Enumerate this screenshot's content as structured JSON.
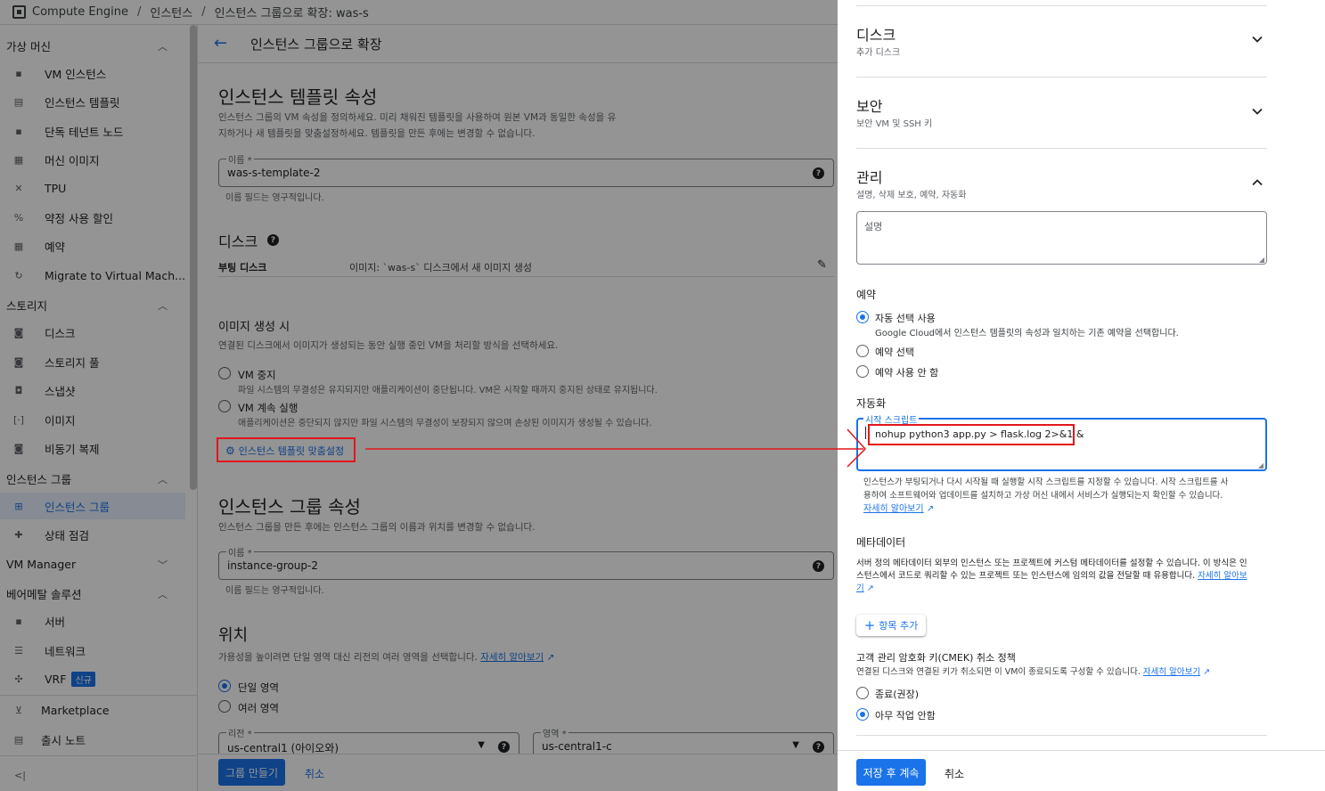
{
  "breadcrumb": {
    "product": "Compute Engine",
    "section": "인스턴스",
    "current": "인스턴스 그룹으로 확장: was-s"
  },
  "sidebar": {
    "sections": [
      {
        "label": "가상 머신"
      },
      {
        "label": "스토리지"
      },
      {
        "label": "인스턴스 그룹"
      },
      {
        "label": "VM Manager"
      },
      {
        "label": "베어메탈 솔루션"
      }
    ],
    "items": [
      {
        "label": "VM 인스턴스"
      },
      {
        "label": "인스턴스 템플릿"
      },
      {
        "label": "단독 테넌트 노드"
      },
      {
        "label": "머신 이미지"
      },
      {
        "label": "TPU"
      },
      {
        "label": "약정 사용 할인"
      },
      {
        "label": "예약"
      },
      {
        "label": "Migrate to Virtual Mach..."
      },
      {
        "label": "디스크"
      },
      {
        "label": "스토리지 풀"
      },
      {
        "label": "스냅샷"
      },
      {
        "label": "이미지"
      },
      {
        "label": "비동기 복제"
      },
      {
        "label": "인스턴스 그룹"
      },
      {
        "label": "상태 점검"
      },
      {
        "label": "서버"
      },
      {
        "label": "네트워크"
      },
      {
        "label": "VRF",
        "badge": "신규"
      },
      {
        "label": "Marketplace"
      },
      {
        "label": "출시 노트"
      }
    ],
    "collapse_label": "<|"
  },
  "main": {
    "page_title": "인스턴스 그룹으로 확장",
    "template_props": {
      "title": "인스턴스 템플릿 속성",
      "desc_line1": "인스턴스 그룹의 VM 속성을 정의하세요. 미리 채워진 템플릿을 사용하여 원본 VM과 동일한 속성을 유",
      "desc_line2": "지하거나 새 템플릿을 맞춤설정하세요. 템플릿을 만든 후에는 변경할 수 없습니다.",
      "name_label": "이름 *",
      "name_value": "was-s-template-2",
      "name_hint": "이름 필드는 영구적입니다."
    },
    "disk": {
      "title": "디스크",
      "boot_label": "부팅 디스크",
      "boot_value": "이미지: `was-s` 디스크에서 새 이미지 생성"
    },
    "image_creation": {
      "title": "이미지 생성 시",
      "desc": "연결된 디스크에서 이미지가 생성되는 동안 실행 중인 VM을 처리할 방식을 선택하세요.",
      "opt1_label": "VM 중지",
      "opt1_desc": "파일 시스템의 무결성은 유지되지만 애플리케이션이 중단됩니다. VM은 시작할 때까지 중지된 상태로 유지됩니다.",
      "opt2_label": "VM 계속 실행",
      "opt2_desc": "애플리케이션은 중단되지 않지만 파일 시스템의 무결성이 보장되지 않으며 손상된 이미지가 생성될 수 있습니다.",
      "customize_label": "인스턴스 템플릿 맞춤설정"
    },
    "group_props": {
      "title": "인스턴스 그룹 속성",
      "desc": "인스턴스 그룹을 만든 후에는 인스턴스 그룹의 이름과 위치를 변경할 수 없습니다.",
      "name_label": "이름 *",
      "name_value": "instance-group-2",
      "name_hint": "이름 필드는 영구적입니다."
    },
    "location": {
      "title": "위치",
      "desc": "가용성을 높이려면 단일 영역 대신 리전의 여러 영역을 선택합니다.",
      "learn_more": "자세히 알아보기",
      "opt_single": "단일 영역",
      "opt_multi": "여러 영역",
      "region_label": "리전 *",
      "region_value": "us-central1 (아이오와)",
      "zone_label": "영역 *",
      "zone_value": "us-central1-c"
    },
    "create_button": "그룹 만들기",
    "cancel_button": "취소"
  },
  "panel": {
    "disk": {
      "title": "디스크",
      "subtitle": "추가 디스크"
    },
    "security": {
      "title": "보안",
      "subtitle": "보안 VM 및 SSH 키"
    },
    "management": {
      "title": "관리",
      "subtitle": "설명, 삭제 보호, 예약, 자동화"
    },
    "description_placeholder": "설명",
    "reservation": {
      "title": "예약",
      "opt_auto": "자동 선택 사용",
      "opt_auto_desc": "Google Cloud에서 인스턴스 템플릿의 속성과 일치하는 기존 예약을 선택합니다.",
      "opt_select": "예약 선택",
      "opt_none": "예약 사용 안 함"
    },
    "automation": {
      "title": "자동화",
      "script_label": "시작 스크립트",
      "script_value": "nohup python3 app.py > flask.log 2>&1 &",
      "help_line1": "인스턴스가 부팅되거나 다시 시작될 때 실행할 시작 스크립트를 지정할 수 있습니다. 시작 스크립트를 사",
      "help_line2": "용하여 소프트웨어와 업데이트를 설치하고 가상 머신 내에서 서비스가 실행되는지 확인할 수 있습니다.",
      "learn_more": "자세히 알아보기"
    },
    "metadata": {
      "title": "메타데이터",
      "desc_line1": "서버 정의 메타데이터 외부의 인스턴스 또는 프로젝트에 커스텀 메타데이터를 설정할 수 있습니다. 이 방식은 인",
      "desc_line2": "스턴스에서 코드로 쿼리할 수 있는 프로젝트 또는 인스턴스에 임의의 값을 전달할 때 유용합니다.",
      "learn_more_a": "자세히 알아보",
      "learn_more_b": "기",
      "add_item": "항목 추가"
    },
    "cmek": {
      "title": "고객 관리 암호화 키(CMEK) 취소 정책",
      "desc": "연결된 디스크와 연결된 키가 취소되면 이 VM이 종료되도록 구성할 수 있습니다.",
      "learn_more": "자세히 알아보기",
      "opt_terminate": "종료(권장)",
      "opt_none": "아무 작업 안함"
    },
    "save_button": "저장 후 계속",
    "cancel_button": "취소"
  },
  "colors": {
    "accent": "#1a73e8",
    "annotation": "#e4161b"
  }
}
